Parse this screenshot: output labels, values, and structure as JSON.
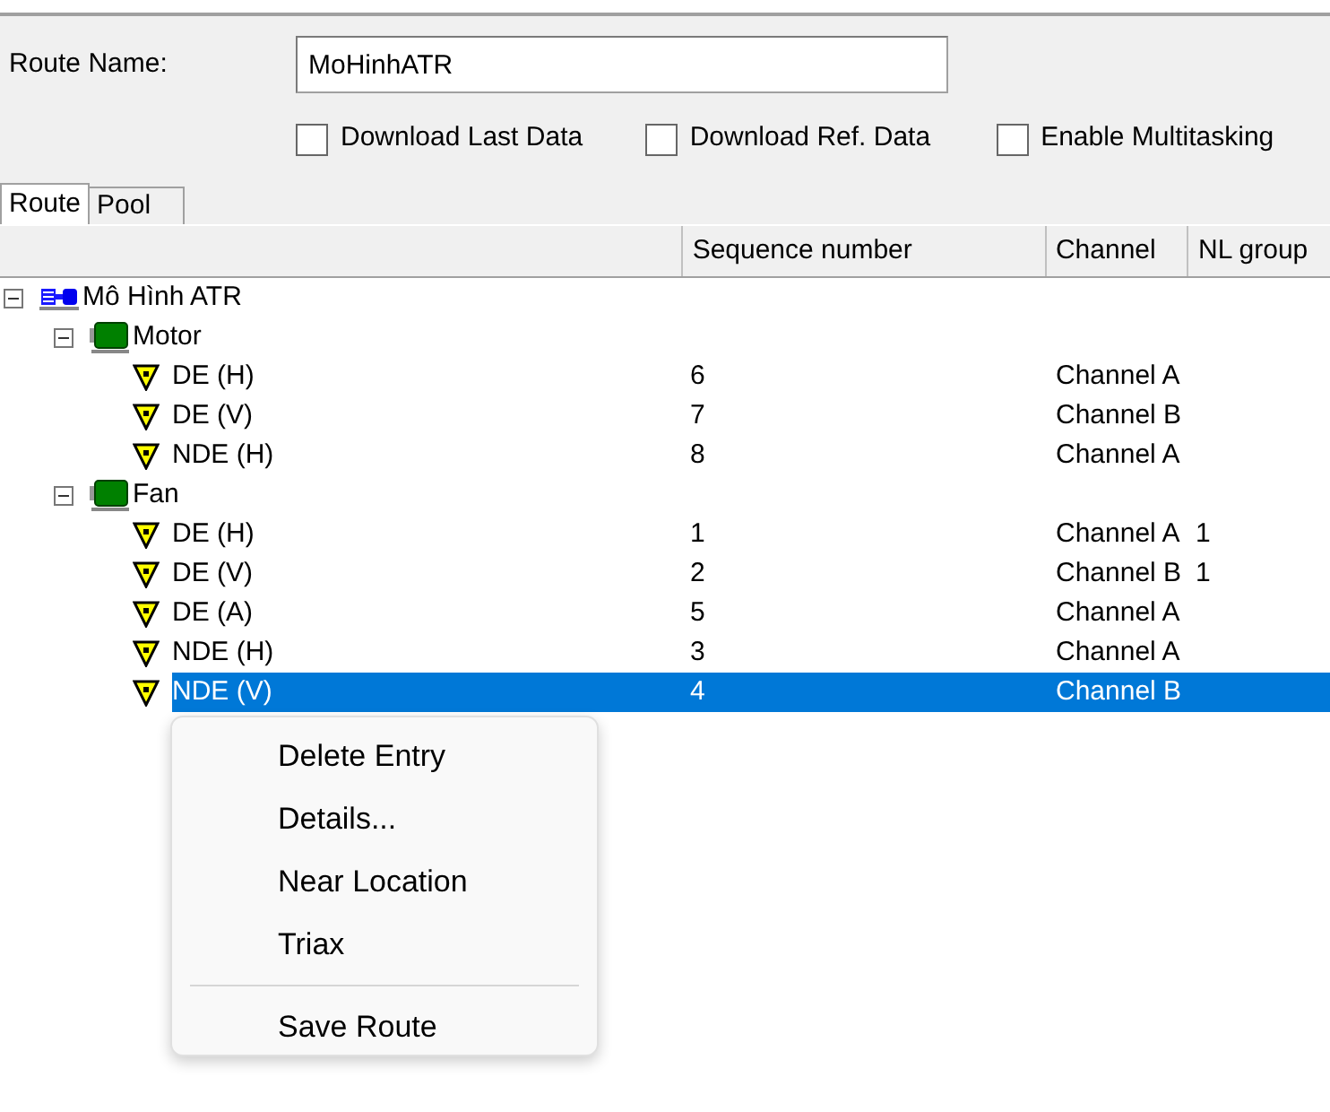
{
  "route_name": {
    "label": "Route Name:",
    "value": "MoHinhATR"
  },
  "options": [
    {
      "label": "Download Last Data",
      "checked": false
    },
    {
      "label": "Download Ref. Data",
      "checked": false
    },
    {
      "label": "Enable Multitasking",
      "checked": false
    }
  ],
  "tabs": [
    {
      "label": "Route",
      "selected": true
    },
    {
      "label": "Pool",
      "selected": false
    }
  ],
  "table": {
    "columns": [
      "Sequence number",
      "Channel",
      "NL group"
    ],
    "tree": [
      {
        "label": "Mô Hình ATR",
        "kind": "machine",
        "expanded": true,
        "selected": false,
        "children": [
          {
            "label": "Motor",
            "kind": "component",
            "expanded": true,
            "selected": false,
            "children": [
              {
                "label": "DE (H)",
                "kind": "point",
                "selected": false,
                "sequence": "6",
                "channel": "Channel A"
              },
              {
                "label": "DE (V)",
                "kind": "point",
                "selected": false,
                "sequence": "7",
                "channel": "Channel B"
              },
              {
                "label": "NDE (H)",
                "kind": "point",
                "selected": false,
                "sequence": "8",
                "channel": "Channel A"
              }
            ]
          },
          {
            "label": "Fan",
            "kind": "component",
            "expanded": true,
            "selected": false,
            "children": [
              {
                "label": "DE (H)",
                "kind": "point",
                "selected": false,
                "sequence": "1",
                "channel": "Channel A",
                "nl_group": "1"
              },
              {
                "label": "DE (V)",
                "kind": "point",
                "selected": false,
                "sequence": "2",
                "channel": "Channel B",
                "nl_group": "1"
              },
              {
                "label": "DE (A)",
                "kind": "point",
                "selected": false,
                "sequence": "5",
                "channel": "Channel A"
              },
              {
                "label": "NDE (H)",
                "kind": "point",
                "selected": false,
                "sequence": "3",
                "channel": "Channel A"
              },
              {
                "label": "NDE (V)",
                "kind": "point",
                "selected": true,
                "sequence": "4",
                "channel": "Channel B"
              }
            ]
          }
        ]
      }
    ]
  },
  "context_menu": {
    "items": [
      {
        "kind": "item",
        "label": "Delete Entry"
      },
      {
        "kind": "item",
        "label": "Details..."
      },
      {
        "kind": "item",
        "label": "Near Location"
      },
      {
        "kind": "item",
        "label": "Triax"
      },
      {
        "kind": "separator"
      },
      {
        "kind": "item",
        "label": "Save Route"
      }
    ]
  }
}
